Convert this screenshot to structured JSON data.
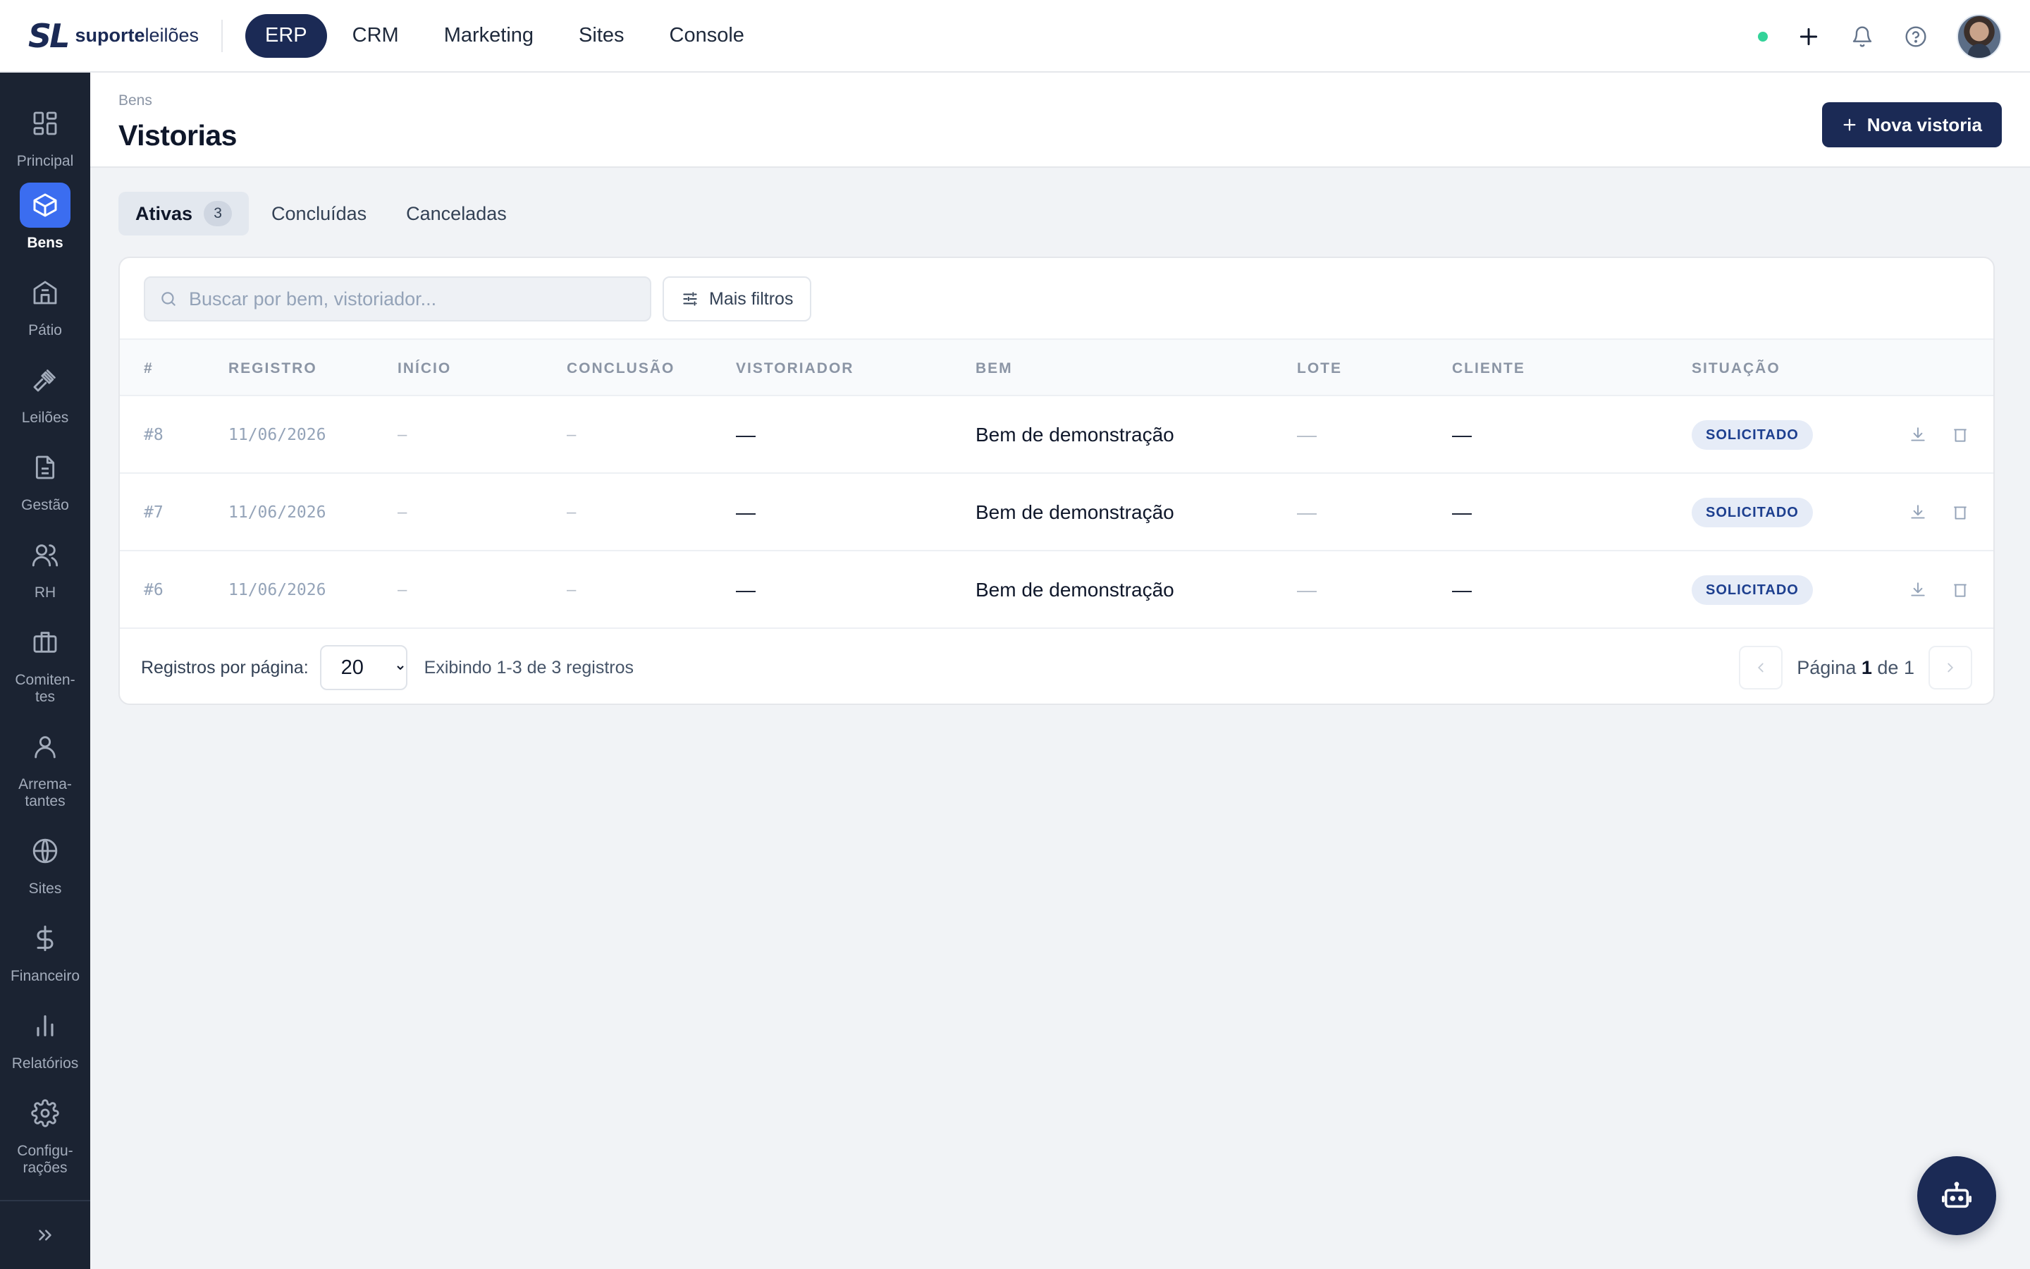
{
  "brand": {
    "mark": "SL",
    "name_bold": "suporte",
    "name_light": "leilões"
  },
  "topnav": [
    {
      "label": "ERP",
      "active": true
    },
    {
      "label": "CRM",
      "active": false
    },
    {
      "label": "Marketing",
      "active": false
    },
    {
      "label": "Sites",
      "active": false
    },
    {
      "label": "Console",
      "active": false
    }
  ],
  "top_actions": {
    "status_color": "#34d399",
    "icons": [
      "plus-icon",
      "bell-icon",
      "help-icon"
    ]
  },
  "sidebar": {
    "items": [
      {
        "label": "Principal",
        "icon": "grid-icon"
      },
      {
        "label": "Bens",
        "icon": "box-icon",
        "active": true
      },
      {
        "label": "Pátio",
        "icon": "building-icon"
      },
      {
        "label": "Leilões",
        "icon": "gavel-icon"
      },
      {
        "label": "Gestão",
        "icon": "document-icon"
      },
      {
        "label": "RH",
        "icon": "users-icon"
      },
      {
        "label": "Comiten-\ntes",
        "icon": "briefcase-icon"
      },
      {
        "label": "Arrema-\ntantes",
        "icon": "user-icon"
      },
      {
        "label": "Sites",
        "icon": "globe-icon"
      },
      {
        "label": "Financeiro",
        "icon": "dollar-icon"
      },
      {
        "label": "Relatórios",
        "icon": "bar-chart-icon"
      },
      {
        "label": "Configu-\nrações",
        "icon": "gear-icon"
      }
    ]
  },
  "page": {
    "breadcrumb": "Bens",
    "title": "Vistorias",
    "new_button": "Nova vistoria"
  },
  "tabs": [
    {
      "label": "Ativas",
      "count": "3",
      "active": true
    },
    {
      "label": "Concluídas"
    },
    {
      "label": "Canceladas"
    }
  ],
  "search": {
    "placeholder": "Buscar por bem, vistoriador...",
    "value": ""
  },
  "filters_button": "Mais filtros",
  "table": {
    "columns": [
      "#",
      "REGISTRO",
      "INÍCIO",
      "CONCLUSÃO",
      "VISTORIADOR",
      "BEM",
      "LOTE",
      "CLIENTE",
      "SITUAÇÃO"
    ],
    "rows": [
      {
        "id": "#8",
        "registro": "11/06/2026",
        "inicio": "–",
        "conclusao": "–",
        "vistoriador": "—",
        "bem": "Bem de demonstração",
        "lote": "—",
        "cliente": "—",
        "situacao": "SOLICITADO"
      },
      {
        "id": "#7",
        "registro": "11/06/2026",
        "inicio": "–",
        "conclusao": "–",
        "vistoriador": "—",
        "bem": "Bem de demonstração",
        "lote": "—",
        "cliente": "—",
        "situacao": "SOLICITADO"
      },
      {
        "id": "#6",
        "registro": "11/06/2026",
        "inicio": "–",
        "conclusao": "–",
        "vistoriador": "—",
        "bem": "Bem de demonstração",
        "lote": "—",
        "cliente": "—",
        "situacao": "SOLICITADO"
      }
    ]
  },
  "footer": {
    "per_page_label": "Registros por página:",
    "per_page_value": "20",
    "range_text": "Exibindo 1-3 de 3 registros",
    "page_prefix": "Página",
    "page_current": "1",
    "page_sep": "de",
    "page_total": "1"
  },
  "colors": {
    "brand": "#1b2a55",
    "sidebar_bg": "#1b2332",
    "active_blue": "#3b6df0",
    "badge_text": "#1d3f8f"
  }
}
